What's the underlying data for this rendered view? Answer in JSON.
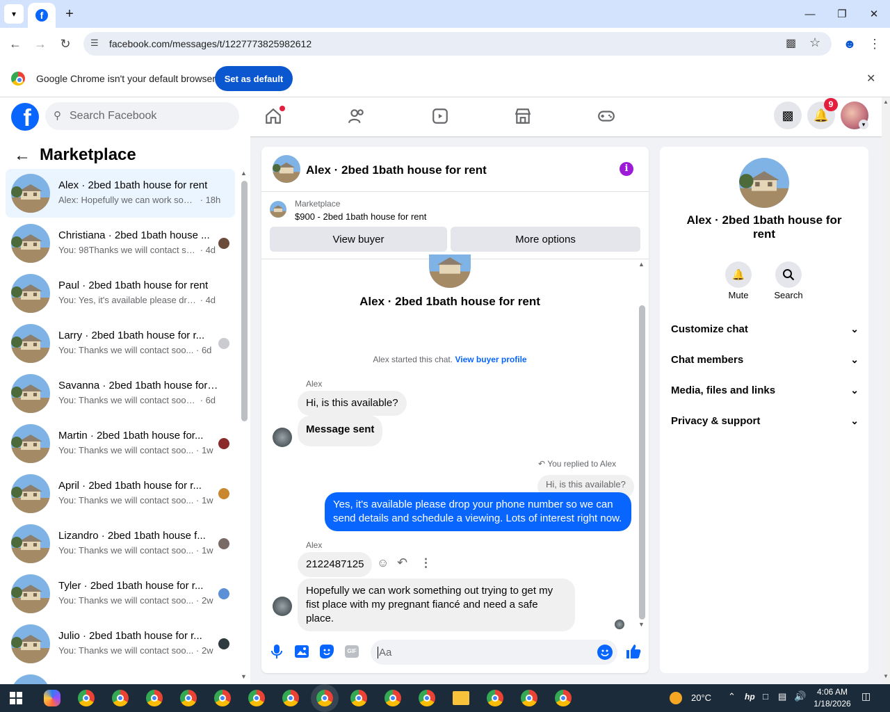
{
  "browser": {
    "url": "facebook.com/messages/t/1227773825982612",
    "infobar_text": "Google Chrome isn't your default browser",
    "set_default_label": "Set as default"
  },
  "header": {
    "search_placeholder": "Search Facebook",
    "notification_count": "9"
  },
  "sidebar": {
    "title": "Marketplace",
    "conversations": [
      {
        "name": "Alex · 2bed 1bath house for rent",
        "preview": "Alex: Hopefully we can work some...",
        "time": "· 18h"
      },
      {
        "name": "Christiana · 2bed 1bath house ...",
        "preview": "You: 98Thanks we will contact so...",
        "time": "· 4d"
      },
      {
        "name": "Paul · 2bed 1bath house for rent",
        "preview": "You: Yes, it's available please drop y...",
        "time": "· 4d"
      },
      {
        "name": "Larry · 2bed 1bath house for r...",
        "preview": "You: Thanks we will contact soo...",
        "time": "· 6d"
      },
      {
        "name": "Savanna · 2bed 1bath house for ...",
        "preview": "You: Thanks we will contact soon w...",
        "time": "· 6d"
      },
      {
        "name": "Martin · 2bed 1bath house for...",
        "preview": "You: Thanks we will contact soo...",
        "time": "· 1w"
      },
      {
        "name": "April · 2bed 1bath house for r...",
        "preview": "You: Thanks we will contact soo...",
        "time": "· 1w"
      },
      {
        "name": "Lizandro · 2bed 1bath house f...",
        "preview": "You: Thanks we will contact soo...",
        "time": "· 1w"
      },
      {
        "name": "Tyler · 2bed 1bath house for r...",
        "preview": "You: Thanks we will contact soo...",
        "time": "· 2w"
      },
      {
        "name": "Julio · 2bed 1bath house for r...",
        "preview": "You: Thanks we will contact soo...",
        "time": "· 2w"
      }
    ]
  },
  "chat": {
    "title": "Alex · 2bed 1bath house for rent",
    "listing_source": "Marketplace",
    "listing_title": "$900 - 2bed 1bath house for rent",
    "view_buyer_label": "View buyer",
    "more_options_label": "More options",
    "intro_name": "Alex · 2bed 1bath house for rent",
    "started_text": "Alex started this chat.",
    "view_profile_link": "View buyer profile",
    "sender_alex": "Alex",
    "msg1": "Hi, is this available?",
    "msg2": "Message sent",
    "replied_label": "You replied to Alex",
    "quoted": "Hi, is this available?",
    "my_reply": "Yes, it's available please drop your phone number so we can send details and schedule a viewing. Lots of interest right now.",
    "sender_alex2": "Alex",
    "msg3": "2122487125",
    "msg4": "Hopefully we can work something out trying to get my fist place with my pregnant fiancé and need a safe place.",
    "composer_placeholder": "Aa"
  },
  "details": {
    "name": "Alex · 2bed 1bath house for rent",
    "mute_label": "Mute",
    "search_label": "Search",
    "sections": [
      "Customize chat",
      "Chat members",
      "Media, files and links",
      "Privacy & support"
    ]
  },
  "taskbar": {
    "weather": "20°C",
    "time": "4:06 AM",
    "date": "1/18/2026"
  },
  "colors": {
    "accent": "#0866ff",
    "info_purple": "#9d1ad6",
    "badge_red": "#e41e3f"
  }
}
